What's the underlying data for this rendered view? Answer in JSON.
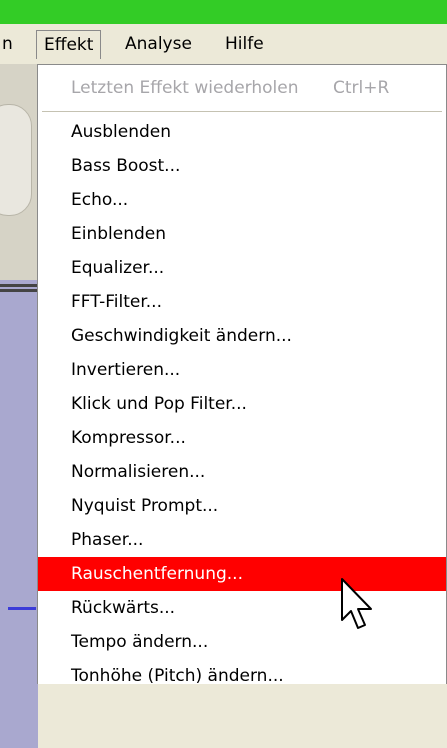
{
  "menubar": {
    "items": [
      "n",
      "Effekt",
      "Analyse",
      "Hilfe"
    ]
  },
  "menu": {
    "repeat": {
      "label": "Letzten Effekt wiederholen",
      "shortcut": "Ctrl+R"
    },
    "items": [
      "Ausblenden",
      "Bass Boost...",
      "Echo...",
      "Einblenden",
      "Equalizer...",
      "FFT-Filter...",
      "Geschwindigkeit ändern...",
      "Invertieren...",
      "Klick und Pop Filter...",
      "Kompressor...",
      "Normalisieren...",
      "Nyquist Prompt...",
      "Phaser...",
      "Rauschentfernung...",
      "Rückwärts...",
      "Tempo ändern...",
      "Tonhöhe (Pitch) ändern..."
    ],
    "selected_index": 13
  },
  "colors": {
    "titlebar": "#33cc26",
    "highlight": "#ff0000",
    "disabled_text": "#a7a6aa"
  },
  "icons": {
    "pointer": "arrow-cursor-icon"
  }
}
